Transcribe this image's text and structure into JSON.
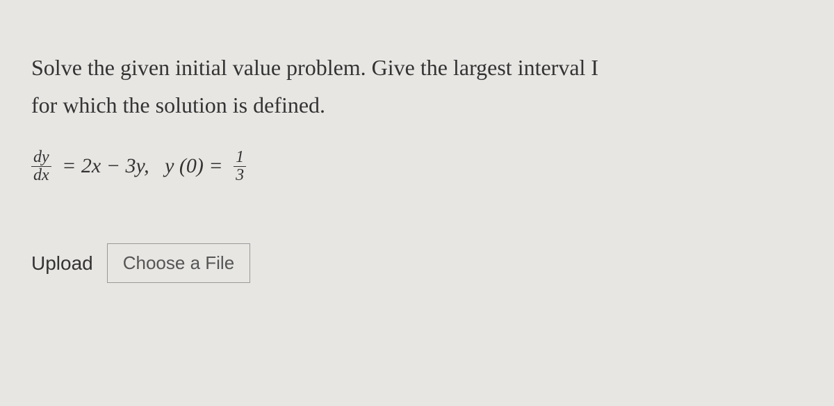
{
  "problem": {
    "line1": "Solve the given initial value problem. Give the largest interval I",
    "line2": "for which the solution is defined."
  },
  "equation": {
    "lhs_num": "dy",
    "lhs_den": "dx",
    "eq1": " = 2x − 3y,   y (0) = ",
    "rhs_num": "1",
    "rhs_den": "3"
  },
  "upload": {
    "label": "Upload",
    "button": "Choose a File"
  }
}
